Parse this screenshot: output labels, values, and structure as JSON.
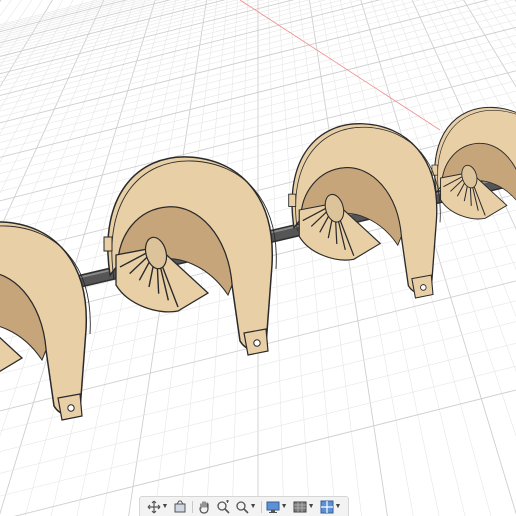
{
  "canvas": {
    "background": "#ffffff",
    "grid_minor_color": "#e6e6e6",
    "grid_major_color": "#cfcfcf",
    "x_axis_color": "#f08a8a",
    "part_body_color": "#e8cfa6",
    "part_shade_color": "#c7a57a",
    "part_outline_color": "#2a2a2a",
    "shaft_color": "#555555",
    "spacer_color": "#dcc39a"
  },
  "model": {
    "assembly_units": 4,
    "description_visible": false
  },
  "nav_bar": {
    "tools": [
      {
        "name": "orbit-icon",
        "has_menu": true
      },
      {
        "name": "look-at-icon",
        "has_menu": false
      },
      {
        "name": "pan-icon",
        "has_menu": false
      },
      {
        "name": "zoom-window-icon",
        "has_menu": false
      },
      {
        "name": "zoom-icon",
        "has_menu": true
      },
      {
        "name": "display-settings-icon",
        "has_menu": true
      },
      {
        "name": "grid-settings-icon",
        "has_menu": true
      },
      {
        "name": "viewports-icon",
        "has_menu": true
      }
    ]
  }
}
